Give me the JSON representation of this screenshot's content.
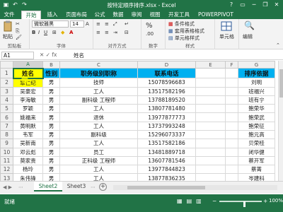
{
  "window": {
    "title": "按特定顺序排序.xlsx - Excel",
    "qa_icons": [
      "save-icon",
      "undo-icon",
      "redo-icon"
    ],
    "controls": [
      "?",
      "▭",
      "─",
      "❐",
      "✕"
    ]
  },
  "tabs": [
    {
      "label": "文件",
      "active": false
    },
    {
      "label": "开始",
      "active": true
    },
    {
      "label": "插入",
      "active": false
    },
    {
      "label": "页面布局",
      "active": false
    },
    {
      "label": "公式",
      "active": false
    },
    {
      "label": "数据",
      "active": false
    },
    {
      "label": "审阅",
      "active": false
    },
    {
      "label": "视图",
      "active": false
    },
    {
      "label": "开发工具",
      "active": false
    },
    {
      "label": "POWERPIVOT",
      "active": false
    }
  ],
  "ribbon": {
    "paste_label": "粘贴",
    "clipboard_label": "剪贴板",
    "font_name": "微软雅黑",
    "font_size": "14",
    "font_label": "字体",
    "align_label": "对齐方式",
    "number_label": "数字",
    "percent": "%",
    "cond_format": "条件格式",
    "table_format": "套用表格格式",
    "cell_style": "单元格样式",
    "styles_label": "样式",
    "cells_btn": "单元格",
    "editing_btn": "编辑"
  },
  "formula_bar": {
    "namebox": "A1",
    "fx": "✕  ✓  fx",
    "value": "姓名"
  },
  "grid": {
    "columns": [
      "A",
      "B",
      "C",
      "D",
      "E",
      "F",
      "G"
    ],
    "row_numbers": [
      "1",
      "2",
      "3",
      "4",
      "5",
      "6",
      "7",
      "8",
      "9",
      "10",
      "11",
      "12",
      "13",
      "14"
    ],
    "headers": [
      "姓名",
      "性别",
      "职务级别职称",
      "联系电话",
      "",
      "",
      "排序依据"
    ],
    "rows": [
      [
        "覃仁纪",
        "男",
        "技师",
        "15078596683",
        "",
        "",
        "刘明"
      ],
      [
        "吴豪宏",
        "男",
        "工人",
        "13517582196",
        "",
        "",
        "班福兴"
      ],
      [
        "李海敏",
        "男",
        "副科级  工程师",
        "13788189520",
        "",
        "",
        "班有宁"
      ],
      [
        "罗颖",
        "男",
        "工人",
        "13807781480",
        "",
        "",
        "鲍荣华"
      ],
      [
        "姚福来",
        "男",
        "退休",
        "13977877773",
        "",
        "",
        "鲍荣武"
      ],
      [
        "黄明默",
        "男",
        "工人",
        "13737993248",
        "",
        "",
        "鲍荣征"
      ],
      [
        "韦军",
        "男",
        "副科级",
        "15296073337",
        "",
        "",
        "鲍元高"
      ],
      [
        "吴新南",
        "男",
        "工人",
        "13517582186",
        "",
        "",
        "贝荣桂"
      ],
      [
        "邓云彪",
        "男",
        "员工",
        "13481889718",
        "",
        "",
        "闭华健"
      ],
      [
        "莫家贵",
        "男",
        "正科级  工程师",
        "13607781546",
        "",
        "",
        "蔡开军"
      ],
      [
        "杨玲",
        "男",
        "工人",
        "13977844823",
        "",
        "",
        "蔡菁"
      ],
      [
        "朱伟锋",
        "男",
        "工人",
        "13877836235",
        "",
        "",
        "岑建科"
      ],
      [
        "彭海江",
        "男",
        "工人",
        "13977832749",
        "",
        "",
        "陈爱斋"
      ]
    ]
  },
  "sheets": {
    "nav": "◀ ▶",
    "tabs": [
      "Sheet2",
      "Sheet3"
    ],
    "active": "Sheet2",
    "more": "⋯"
  },
  "status": {
    "ready": "就绪",
    "zoom_value": "100%"
  },
  "colors": {
    "excel_green": "#217346",
    "header_blue": "#00b0f0",
    "highlight_yellow": "#ffff00"
  }
}
